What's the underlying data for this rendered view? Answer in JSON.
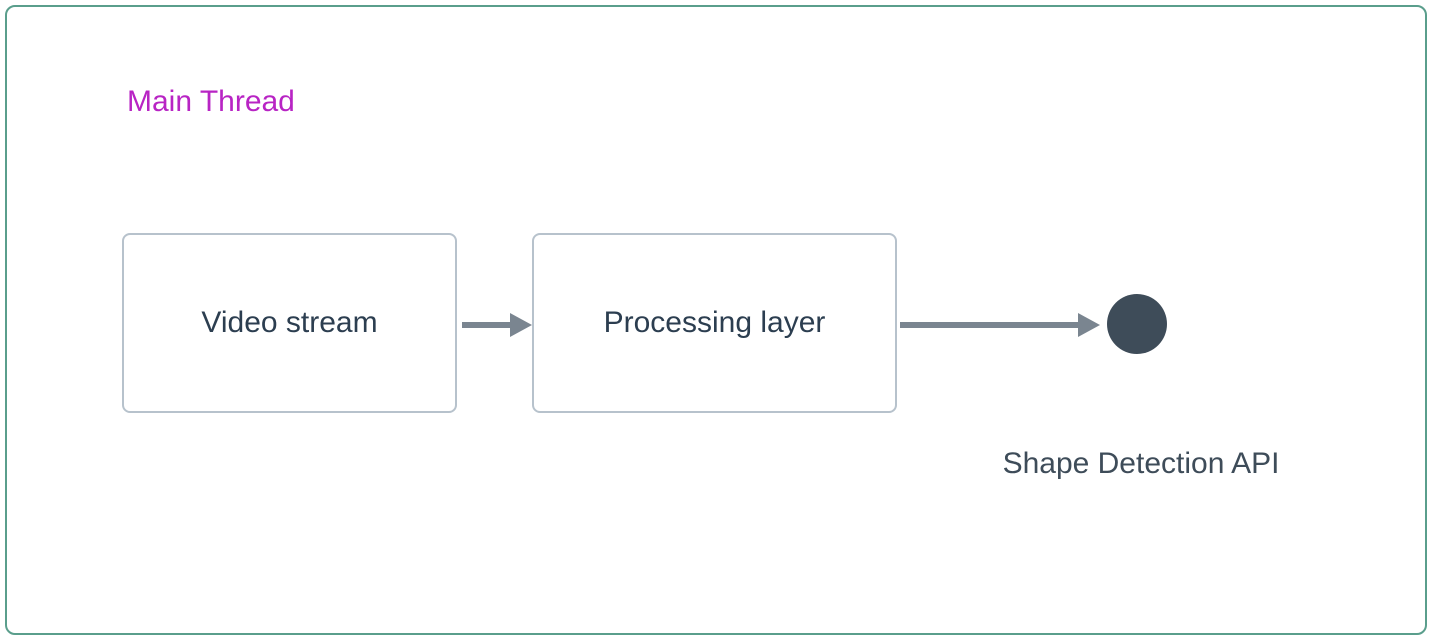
{
  "thread": {
    "label": "Main Thread"
  },
  "nodes": {
    "video_stream": "Video stream",
    "processing_layer": "Processing layer",
    "shape_detection_api": "Shape Detection API"
  },
  "colors": {
    "frame_border": "#5a9e8c",
    "box_border": "#b7c2cc",
    "thread_label": "#b824c4",
    "text": "#2c3e50",
    "arrow": "#7a8590",
    "circle": "#3e4c59"
  }
}
